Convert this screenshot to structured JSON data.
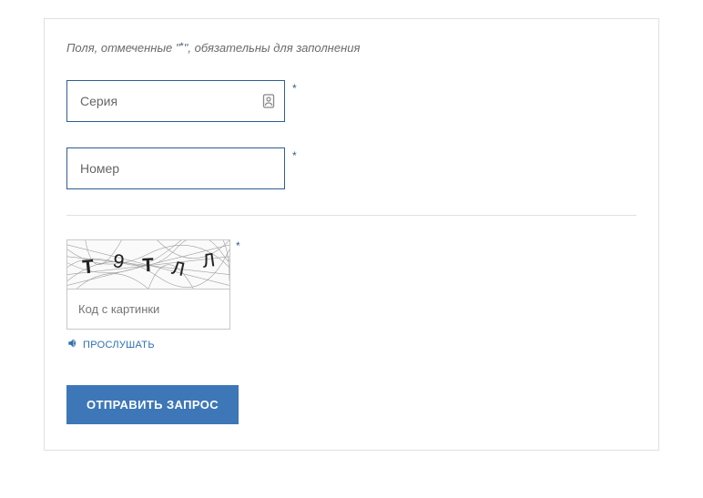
{
  "hint": {
    "prefix": "Поля, отмеченные \"",
    "star": "*",
    "suffix": "\", обязательны для заполнения"
  },
  "fields": {
    "series": {
      "placeholder": "Серия",
      "value": ""
    },
    "number": {
      "placeholder": "Номер",
      "value": ""
    }
  },
  "captcha": {
    "chars": [
      "Т",
      "9",
      "Т",
      "Л",
      "Л"
    ],
    "input_placeholder": "Код с картинки",
    "listen_label": "ПРОСЛУШАТЬ"
  },
  "submit_label": "ОТПРАВИТЬ ЗАПРОС",
  "required_marker": "*"
}
